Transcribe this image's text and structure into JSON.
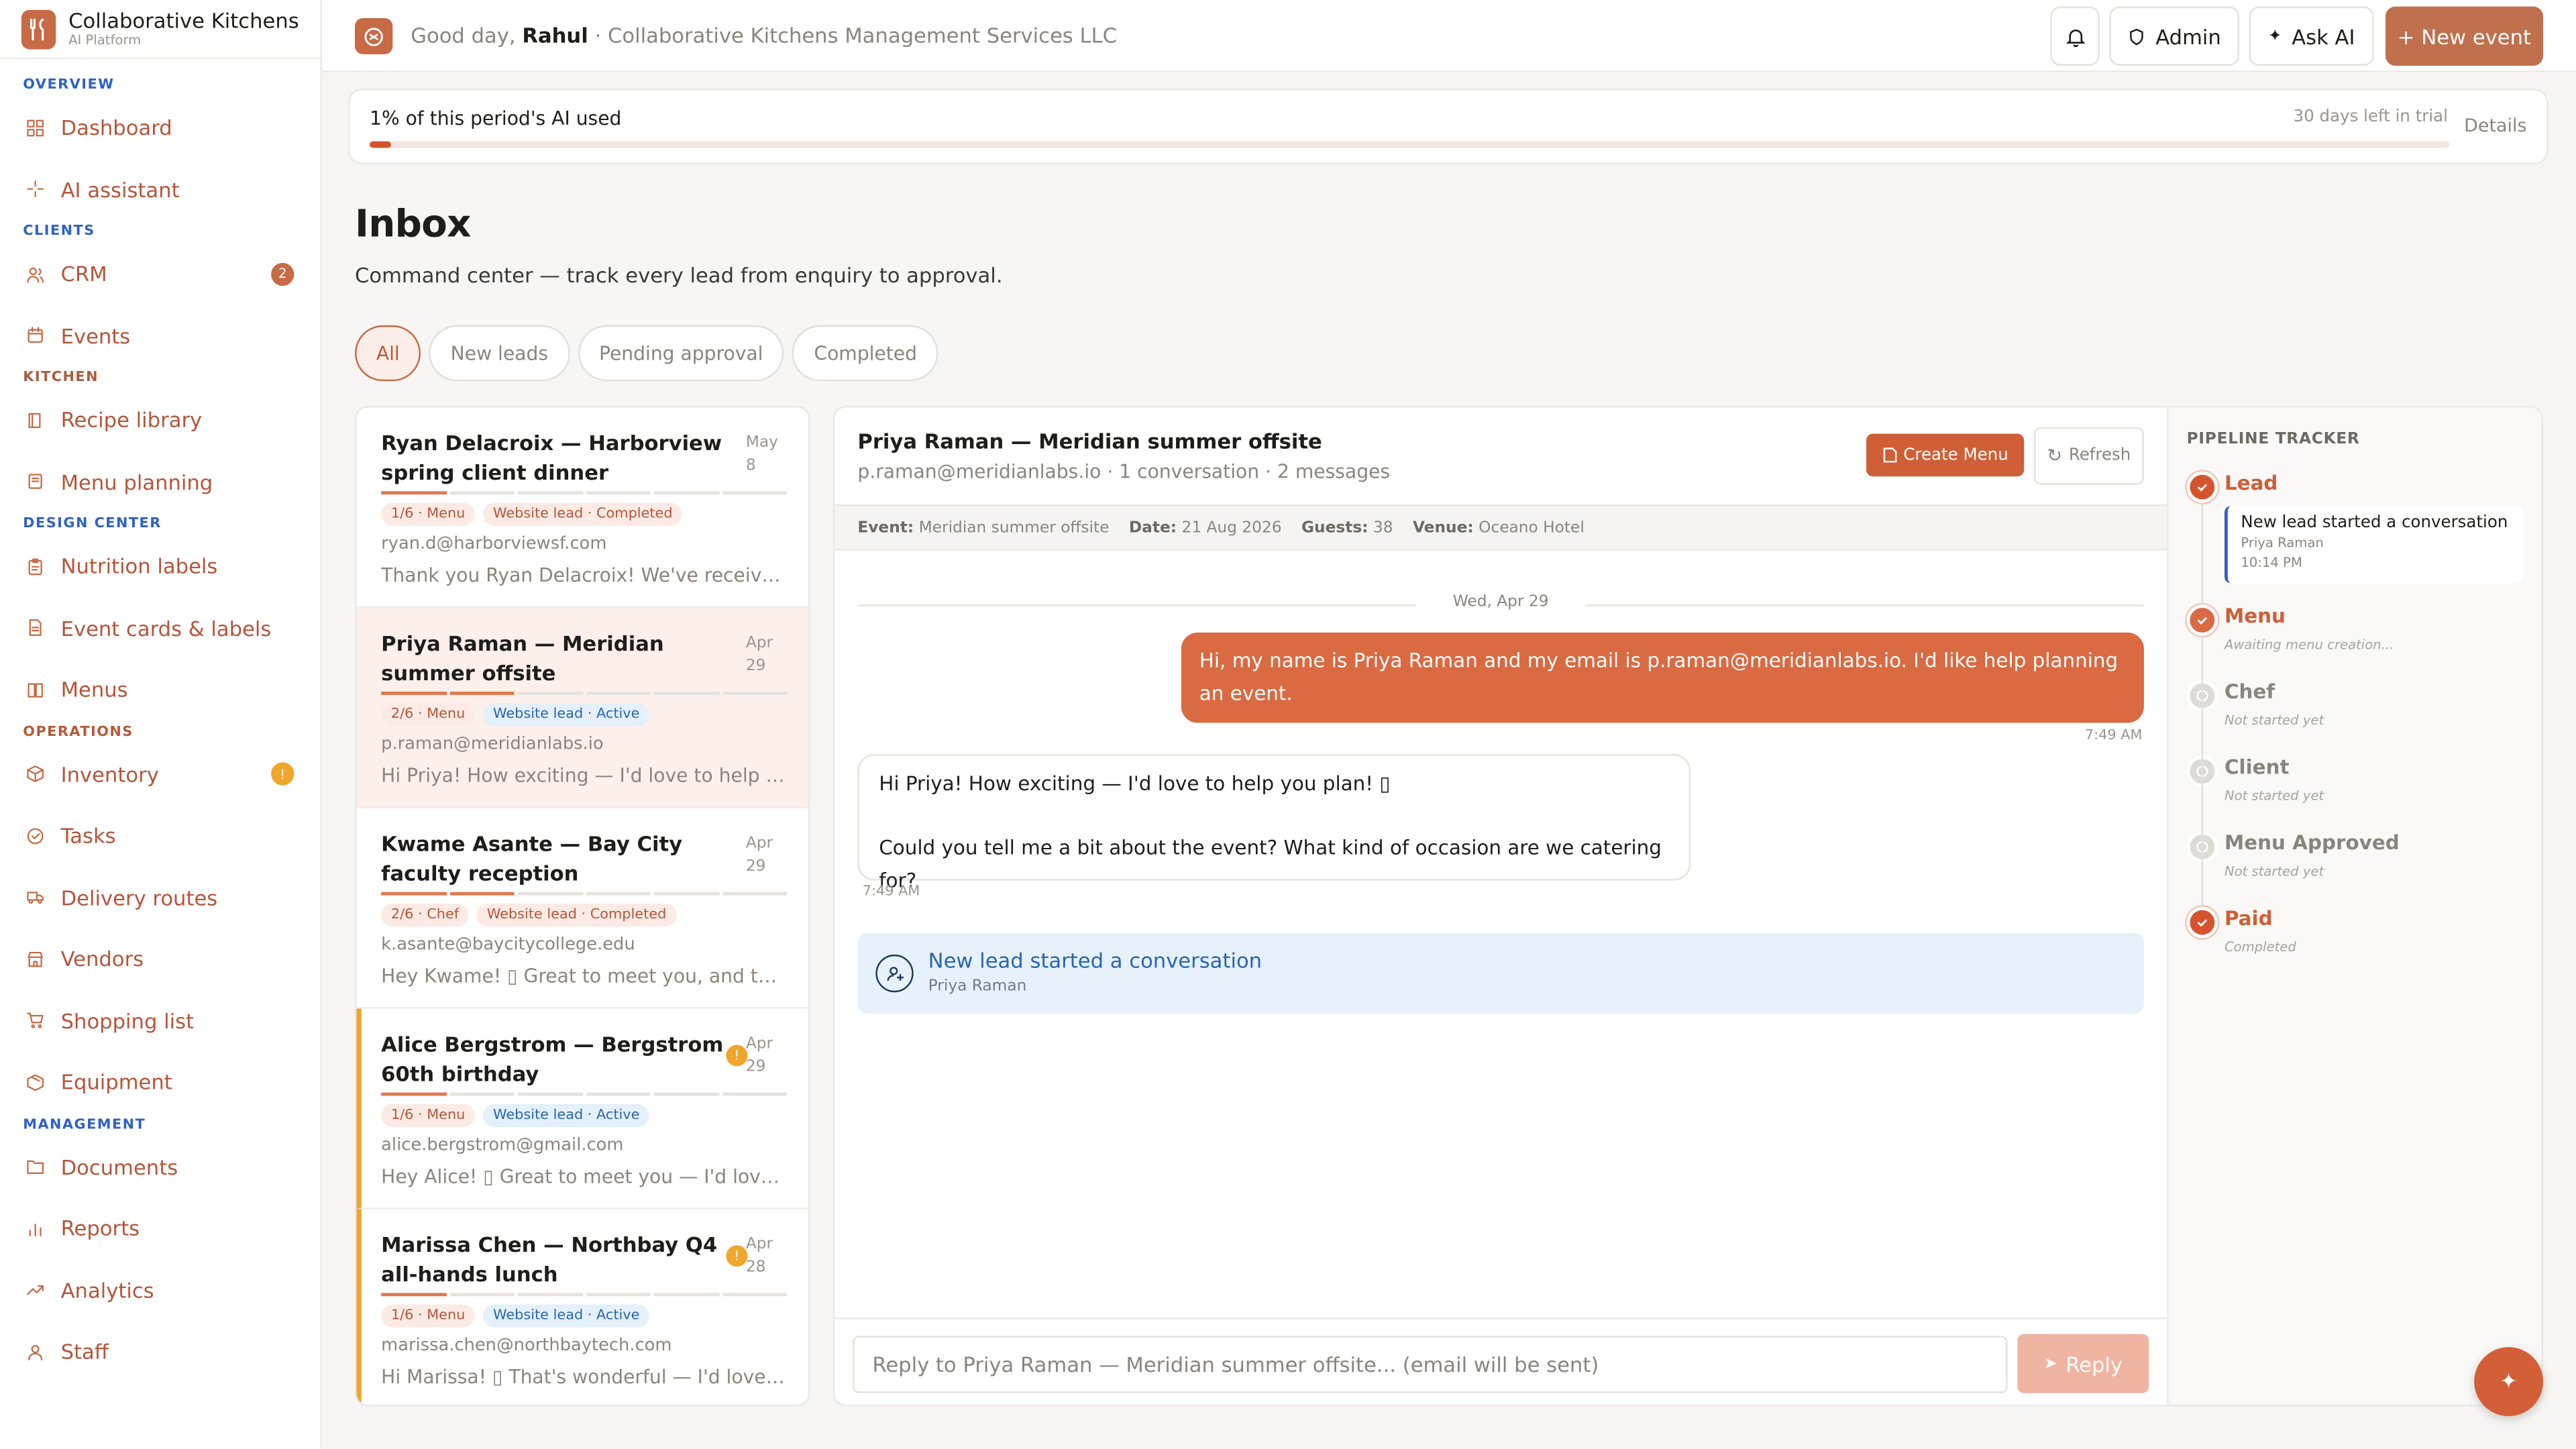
{
  "brand": {
    "title": "Collaborative Kitchens",
    "subtitle": "AI Platform",
    "accent": "#c76a45"
  },
  "sidebar": {
    "sections": [
      {
        "label": "OVERVIEW",
        "items": [
          {
            "label": "Dashboard",
            "icon": "grid-icon"
          },
          {
            "label": "AI assistant",
            "icon": "sparkle-icon"
          }
        ]
      },
      {
        "label": "CLIENTS",
        "items": [
          {
            "label": "CRM",
            "icon": "users-icon",
            "badge": "2"
          },
          {
            "label": "Events",
            "icon": "calendar-icon"
          }
        ]
      },
      {
        "label": "KITCHEN",
        "items": [
          {
            "label": "Recipe library",
            "icon": "book-icon"
          },
          {
            "label": "Menu planning",
            "icon": "notebook-icon"
          }
        ]
      },
      {
        "label": "DESIGN CENTER",
        "items": [
          {
            "label": "Nutrition labels",
            "icon": "clipboard-icon"
          },
          {
            "label": "Event cards & labels",
            "icon": "file-icon"
          },
          {
            "label": "Menus",
            "icon": "book-open-icon"
          }
        ]
      },
      {
        "label": "OPERATIONS",
        "items": [
          {
            "label": "Inventory",
            "icon": "box-icon",
            "badge": "!"
          },
          {
            "label": "Tasks",
            "icon": "check-circle-icon"
          },
          {
            "label": "Delivery routes",
            "icon": "truck-icon"
          },
          {
            "label": "Vendors",
            "icon": "store-icon"
          },
          {
            "label": "Shopping list",
            "icon": "cart-icon"
          },
          {
            "label": "Equipment",
            "icon": "package-icon"
          }
        ]
      },
      {
        "label": "MANAGEMENT",
        "items": [
          {
            "label": "Documents",
            "icon": "folder-icon"
          },
          {
            "label": "Reports",
            "icon": "bar-chart-icon"
          },
          {
            "label": "Analytics",
            "icon": "trend-icon"
          },
          {
            "label": "Staff",
            "icon": "staff-icon"
          }
        ]
      }
    ]
  },
  "topbar": {
    "greeting": "Good day,",
    "user": "Rahul",
    "company": "· Collaborative Kitchens Management Services LLC",
    "admin_label": "Admin",
    "ask_ai_label": "Ask AI",
    "new_event_label": "+ New event"
  },
  "usage": {
    "label": "1% of this period's AI used",
    "percent": 1,
    "days_left": "30 days left in trial",
    "details_label": "Details"
  },
  "page": {
    "title": "Inbox",
    "subtitle": "Command center — track every lead from enquiry to approval."
  },
  "filters": {
    "tabs": [
      "All",
      "New leads",
      "Pending approval",
      "Completed"
    ],
    "active": "All"
  },
  "leads": [
    {
      "title": "Ryan Delacroix — Harborview spring client dinner",
      "date": "May 8",
      "progress": 1,
      "stage_tag": "1/6 · Menu",
      "source_tag": "Website lead · Completed",
      "email": "ryan.d@harborviewsf.com",
      "preview": "Thank you Ryan Delacroix! We've received your request",
      "selected": false,
      "flag": false
    },
    {
      "title": "Priya Raman — Meridian summer offsite",
      "date": "Apr 29",
      "progress": 2,
      "stage_tag": "2/6 · Menu",
      "source_tag": "Website lead · Active",
      "email": "p.raman@meridianlabs.io",
      "preview": "Hi Priya! How exciting — I'd love to help you plan",
      "selected": true,
      "flag": false
    },
    {
      "title": "Kwame Asante — Bay City faculty reception",
      "date": "Apr 29",
      "progress": 2,
      "stage_tag": "2/6 · Chef",
      "source_tag": "Website lead · Completed",
      "email": "k.asante@baycitycollege.edu",
      "preview": "Hey Kwame! ▯ Great to meet you, and thank you",
      "selected": false,
      "flag": false
    },
    {
      "title": "Alice Bergstrom — Bergstrom 60th birthday",
      "date": "Apr 29",
      "progress": 1,
      "stage_tag": "1/6 · Menu",
      "source_tag": "Website lead · Active",
      "email": "alice.bergstrom@gmail.com",
      "preview": "Hey Alice! ▯ Great to meet you — I'd love to help",
      "selected": false,
      "flag": true
    },
    {
      "title": "Marissa Chen — Northbay Q4 all-hands lunch",
      "date": "Apr 28",
      "progress": 1,
      "stage_tag": "1/6 · Menu",
      "source_tag": "Website lead · Active",
      "email": "marissa.chen@northbaytech.com",
      "preview": "Hi Marissa! ▯ That's wonderful — I'd love to help",
      "selected": false,
      "flag": true
    }
  ],
  "conversation": {
    "title": "Priya Raman — Meridian summer offsite",
    "subtitle": "p.raman@meridianlabs.io · 1 conversation · 2 messages",
    "create_menu_label": "Create Menu",
    "refresh_label": "Refresh",
    "meta": {
      "event_label": "Event:",
      "event": "Meridian summer offsite",
      "date_label": "Date:",
      "date": "21 Aug 2026",
      "guests_label": "Guests:",
      "guests": "38",
      "venue_label": "Venue:",
      "venue": "Oceano Hotel"
    },
    "day_divider": "Wed, Apr 29",
    "outgoing": {
      "text": "Hi, my name is Priya Raman and my email is p.raman@meridianlabs.io. I'd like help planning an event.",
      "time": "7:49 AM"
    },
    "incoming": {
      "line1": "Hi Priya! How exciting — I'd love to help you plan! ▯",
      "line2": "Could you tell me a bit about the event? What kind of occasion are we catering for?",
      "time": "7:49 AM"
    },
    "system": {
      "title": "New lead started a conversation",
      "subtitle": "Priya Raman"
    },
    "reply_placeholder": "Reply to Priya Raman — Meridian summer offsite... (email will be sent)",
    "reply_label": "Reply"
  },
  "pipeline": {
    "heading": "PIPELINE TRACKER",
    "steps": [
      {
        "name": "Lead",
        "state": "done",
        "note": ""
      },
      {
        "name": "Menu",
        "state": "current",
        "note": "Awaiting menu creation..."
      },
      {
        "name": "Chef",
        "state": "pending",
        "note": "Not started yet"
      },
      {
        "name": "Client",
        "state": "pending",
        "note": "Not started yet"
      },
      {
        "name": "Menu Approved",
        "state": "pending",
        "note": "Not started yet"
      },
      {
        "name": "Paid",
        "state": "done",
        "note": "Completed"
      }
    ],
    "lead_card": {
      "title": "New lead started a conversation",
      "name": "Priya Raman",
      "time": "10:14 PM"
    }
  }
}
